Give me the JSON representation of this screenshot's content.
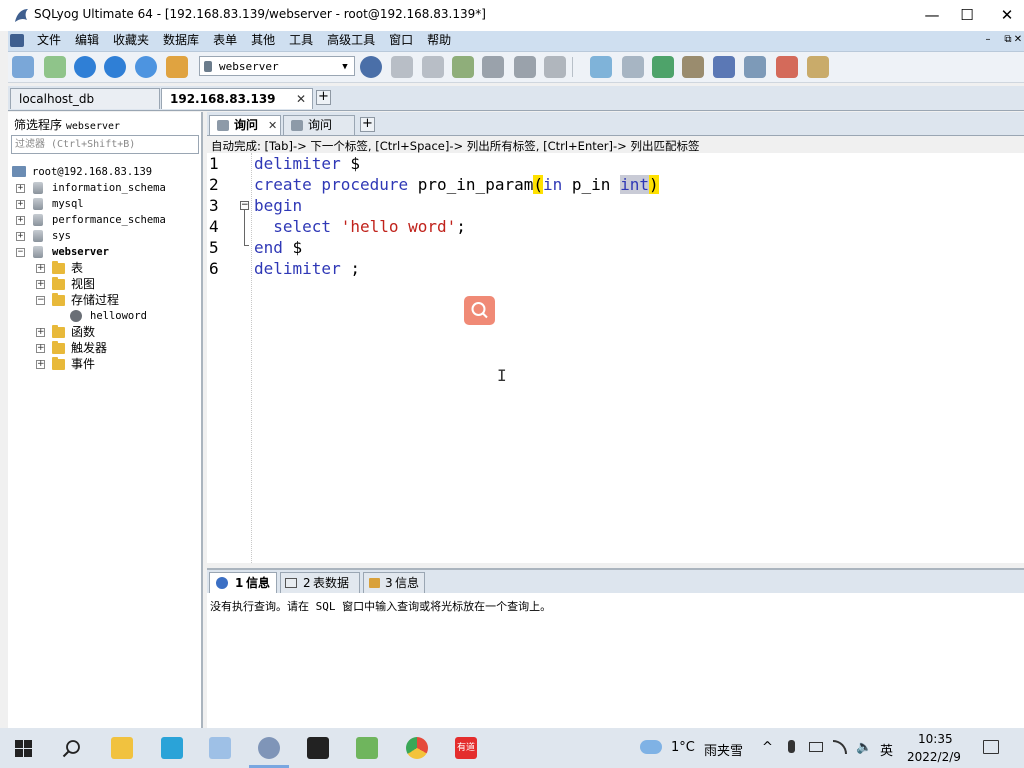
{
  "window": {
    "title": "SQLyog Ultimate 64 - [192.168.83.139/webserver - root@192.168.83.139*]",
    "controls": {
      "minimize": "—",
      "maximize": "☐",
      "close": "✕"
    }
  },
  "menu": {
    "items": [
      "文件",
      "编辑",
      "收藏夹",
      "数据库",
      "表单",
      "其他",
      "工具",
      "高级工具",
      "窗口",
      "帮助"
    ],
    "mdi_controls": {
      "minimize": "–",
      "restore": "⧉",
      "close": "✕"
    }
  },
  "toolbar": {
    "database_select": "webserver"
  },
  "connection_tabs": [
    {
      "label": "localhost_db"
    },
    {
      "label": "192.168.83.139",
      "close": "✕"
    }
  ],
  "left_panel": {
    "filter_title": "筛选程序",
    "filter_db": "webserver",
    "filter_placeholder": "过滤器 (Ctrl+Shift+B)",
    "root": "root@192.168.83.139",
    "databases": [
      "information_schema",
      "mysql",
      "performance_schema",
      "sys",
      "webserver"
    ],
    "webserver_children": [
      "表",
      "视图",
      "存储过程",
      "函数",
      "触发器",
      "事件"
    ],
    "procedure": "helloword"
  },
  "query_tabs": [
    {
      "label": "询问",
      "close": "✕"
    },
    {
      "label": "询问"
    }
  ],
  "hint": "自动完成: [Tab]-> 下一个标签, [Ctrl+Space]-> 列出所有标签, [Ctrl+Enter]-> 列出匹配标签",
  "editor": {
    "line_numbers": [
      "1",
      "2",
      "3",
      "4",
      "5",
      "6"
    ],
    "tokens": {
      "l1_kw": "delimiter",
      "l1_rest": " $",
      "l2_kw": "create procedure",
      "l2_name": " pro_in_param",
      "l2_paren_open": "(",
      "l2_in": "in",
      "l2_param": " p_in ",
      "l2_type": "int",
      "l2_paren_close": ")",
      "l3_kw": "begin",
      "l4_indent": "  ",
      "l4_kw": "select",
      "l4_sp": " ",
      "l4_str": "'hello word'",
      "l4_end": ";",
      "l5_kw": "end",
      "l5_rest": " $",
      "l6_kw": "delimiter",
      "l6_rest": " ;"
    }
  },
  "result_tabs": [
    {
      "num": "1",
      "label": "信息"
    },
    {
      "num": "2",
      "label": "表数据"
    },
    {
      "num": "3",
      "label": "信息"
    }
  ],
  "result_message": "没有执行查询。请在 SQL 窗口中输入查询或将光标放在一个查询上。",
  "taskbar": {
    "weather_temp": "1°C",
    "weather_text": "雨夹雪",
    "ime": "英",
    "time": "10:35",
    "date": "2022/2/9",
    "youdao_label": "有道"
  }
}
